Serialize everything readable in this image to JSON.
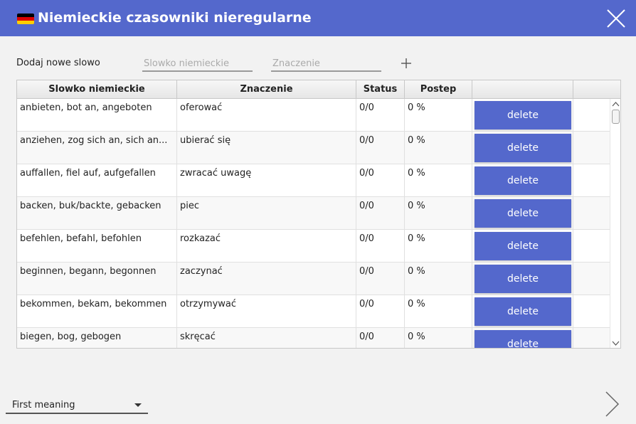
{
  "window": {
    "title": "Niemieckie czasowniki nieregularne",
    "flag_colors": [
      "#000000",
      "#dd0000",
      "#ffce00"
    ],
    "accent_color": "#5468cc"
  },
  "add_form": {
    "label": "Dodaj nowe slowo",
    "german_placeholder": "Slowko niemieckie",
    "meaning_placeholder": "Znaczenie",
    "add_icon": "plus-icon"
  },
  "table": {
    "columns": [
      "Slowko niemieckie",
      "Znaczenie",
      "Status",
      "Postep",
      ""
    ],
    "delete_label": "delete",
    "rows": [
      {
        "word": "anbieten, bot an, angeboten",
        "meaning": "oferować",
        "status": "0/0",
        "progress": "0 %"
      },
      {
        "word": "anziehen, zog sich an, sich an...",
        "meaning": "ubierać się",
        "status": "0/0",
        "progress": "0 %"
      },
      {
        "word": "auffallen, fiel auf, aufgefallen",
        "meaning": "zwracać uwagę",
        "status": "0/0",
        "progress": "0 %"
      },
      {
        "word": "backen, buk/backte, gebacken",
        "meaning": "piec",
        "status": "0/0",
        "progress": "0 %"
      },
      {
        "word": "befehlen, befahl, befohlen",
        "meaning": "rozkazać",
        "status": "0/0",
        "progress": "0 %"
      },
      {
        "word": "beginnen, begann, begonnen",
        "meaning": "zaczynać",
        "status": "0/0",
        "progress": "0 %"
      },
      {
        "word": "bekommen, bekam, bekommen",
        "meaning": "otrzymywać",
        "status": "0/0",
        "progress": "0 %"
      },
      {
        "word": "biegen, bog, gebogen",
        "meaning": "skręcać",
        "status": "0/0",
        "progress": "0 %"
      }
    ]
  },
  "footer": {
    "mode_selected": "First meaning",
    "next_icon": "chevron-right-icon"
  }
}
